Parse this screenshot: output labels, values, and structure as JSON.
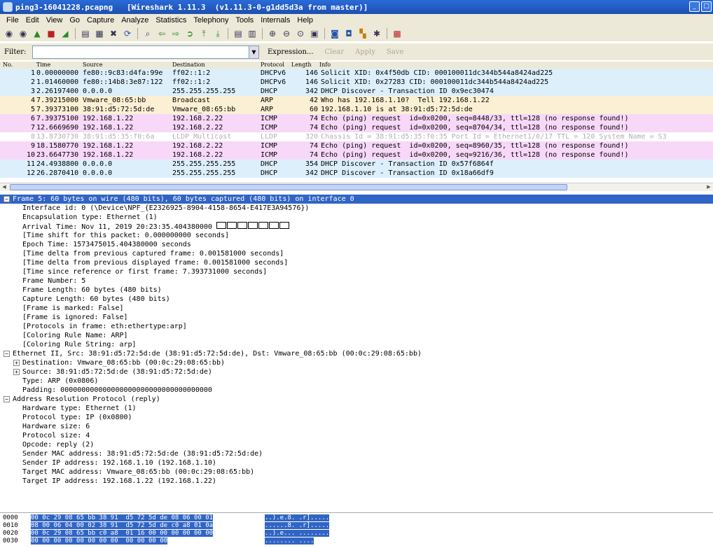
{
  "window": {
    "title": "ping3-16041228.pcapng   [Wireshark 1.11.3  (v1.11.3-0-g1dd5d3a from master)]",
    "buttons": [
      "_",
      "□"
    ]
  },
  "menu": [
    "File",
    "Edit",
    "View",
    "Go",
    "Capture",
    "Analyze",
    "Statistics",
    "Telephony",
    "Tools",
    "Internals",
    "Help"
  ],
  "toolbar": {
    "icons": [
      {
        "name": "interfaces-icon",
        "glyph": "◉",
        "cls": ""
      },
      {
        "name": "options-icon",
        "glyph": "◉",
        "cls": ""
      },
      {
        "name": "start-capture-icon",
        "glyph": "▲",
        "cls": "g"
      },
      {
        "name": "stop-capture-icon",
        "glyph": "■",
        "cls": "r"
      },
      {
        "name": "restart-capture-icon",
        "glyph": "◢",
        "cls": "g"
      },
      {
        "name": "sep"
      },
      {
        "name": "open-file-icon",
        "glyph": "▤",
        "cls": ""
      },
      {
        "name": "save-file-icon",
        "glyph": "▦",
        "cls": ""
      },
      {
        "name": "close-file-icon",
        "glyph": "✖",
        "cls": ""
      },
      {
        "name": "reload-icon",
        "glyph": "⟳",
        "cls": "b"
      },
      {
        "name": "sep"
      },
      {
        "name": "find-packet-icon",
        "glyph": "⌕",
        "cls": ""
      },
      {
        "name": "go-back-icon",
        "glyph": "⇦",
        "cls": "g"
      },
      {
        "name": "go-forward-icon",
        "glyph": "⇨",
        "cls": "g"
      },
      {
        "name": "go-to-packet-icon",
        "glyph": "➲",
        "cls": "g"
      },
      {
        "name": "first-packet-icon",
        "glyph": "⤒",
        "cls": "g"
      },
      {
        "name": "last-packet-icon",
        "glyph": "⤓",
        "cls": "g"
      },
      {
        "name": "sep"
      },
      {
        "name": "colorize-icon",
        "glyph": "▤",
        "cls": ""
      },
      {
        "name": "autoscroll-icon",
        "glyph": "▥",
        "cls": ""
      },
      {
        "name": "sep"
      },
      {
        "name": "zoom-in-icon",
        "glyph": "⊕",
        "cls": ""
      },
      {
        "name": "zoom-out-icon",
        "glyph": "⊖",
        "cls": ""
      },
      {
        "name": "zoom-normal-icon",
        "glyph": "⊙",
        "cls": ""
      },
      {
        "name": "resize-columns-icon",
        "glyph": "▣",
        "cls": ""
      },
      {
        "name": "sep"
      },
      {
        "name": "capture-filters-icon",
        "glyph": "◙",
        "cls": "b"
      },
      {
        "name": "display-filters-icon",
        "glyph": "◘",
        "cls": "b"
      },
      {
        "name": "coloring-rules-icon",
        "glyph": "▚",
        "cls": "o"
      },
      {
        "name": "preferences-icon",
        "glyph": "✱",
        "cls": ""
      },
      {
        "name": "sep"
      },
      {
        "name": "help-icon",
        "glyph": "▩",
        "cls": "r"
      }
    ]
  },
  "filter": {
    "label": "Filter:",
    "value": "",
    "expression": "Expression...",
    "clear": "Clear",
    "apply": "Apply",
    "save": "Save"
  },
  "columns": {
    "no": "No.",
    "time": "Time",
    "source": "Source",
    "destination": "Destination",
    "protocol": "Protocol",
    "length": "Length",
    "info": "Info"
  },
  "colors": {
    "dhcp": "#dceffb",
    "arp": "#fcf0d4",
    "icmp": "#f8d8f8",
    "lldp": "#ffffff",
    "selected": "#3165c5"
  },
  "packets": [
    {
      "no": "1",
      "time": "0.00000000",
      "src": "fe80::9c83:d4fa:99e",
      "dst": "ff02::1:2",
      "proto": "DHCPv6",
      "len": "146",
      "info": "Solicit XID: 0x4f50db CID: 000100011dc344b544a8424ad225",
      "kind": "dhcp"
    },
    {
      "no": "2",
      "time": "1.01460000",
      "src": "fe80::14b8:3e87:122",
      "dst": "ff02::1:2",
      "proto": "DHCPv6",
      "len": "146",
      "info": "Solicit XID: 0x27283 CID: 000100011dc344b544a8424ad225",
      "kind": "dhcp"
    },
    {
      "no": "3",
      "time": "2.26197400",
      "src": "0.0.0.0",
      "dst": "255.255.255.255",
      "proto": "DHCP",
      "len": "342",
      "info": "DHCP Discover - Transaction ID 0x9ec30474",
      "kind": "dhcp"
    },
    {
      "no": "4",
      "time": "7.39215000",
      "src": "Vmware_08:65:bb",
      "dst": "Broadcast",
      "proto": "ARP",
      "len": "42",
      "info": "Who has 192.168.1.10?  Tell 192.168.1.22",
      "kind": "arp"
    },
    {
      "no": "5",
      "time": "7.39373100",
      "src": "38:91:d5:72:5d:de",
      "dst": "Vmware_08:65:bb",
      "proto": "ARP",
      "len": "60",
      "info": "192.168.1.10 is at 38:91:d5:72:5d:de",
      "kind": "arp"
    },
    {
      "no": "6",
      "time": "7.39375100",
      "src": "192.168.1.22",
      "dst": "192.168.2.22",
      "proto": "ICMP",
      "len": "74",
      "info": "Echo (ping) request  id=0x0200, seq=8448/33, ttl=128 (no response found!)",
      "kind": "icmp"
    },
    {
      "no": "7",
      "time": "12.6669690",
      "src": "192.168.1.22",
      "dst": "192.168.2.22",
      "proto": "ICMP",
      "len": "74",
      "info": "Echo (ping) request  id=0x0200, seq=8704/34, ttl=128 (no response found!)",
      "kind": "icmp"
    },
    {
      "no": "8",
      "time": "13.8730730",
      "src": "38:91:d5:35:f0:6a",
      "dst": "LLDP_Multicast",
      "proto": "LLDP",
      "len": "320",
      "info": "Chassis Id = 38:91:d5:35:f0:35 Port Id = Ethernet1/0/17 TTL = 120 System Name = S3",
      "kind": "lldp"
    },
    {
      "no": "9",
      "time": "18.1580770",
      "src": "192.168.1.22",
      "dst": "192.168.2.22",
      "proto": "ICMP",
      "len": "74",
      "info": "Echo (ping) request  id=0x0200, seq=8960/35, ttl=128 (no response found!)",
      "kind": "icmp"
    },
    {
      "no": "10",
      "time": "23.6647730",
      "src": "192.168.1.22",
      "dst": "192.168.2.22",
      "proto": "ICMP",
      "len": "74",
      "info": "Echo (ping) request  id=0x0200, seq=9216/36, ttl=128 (no response found!)",
      "kind": "icmp"
    },
    {
      "no": "11",
      "time": "24.4938800",
      "src": "0.0.0.0",
      "dst": "255.255.255.255",
      "proto": "DHCP",
      "len": "354",
      "info": "DHCP Discover - Transaction ID 0x57f6864f",
      "kind": "dhcp"
    },
    {
      "no": "12",
      "time": "26.2870410",
      "src": "0.0.0.0",
      "dst": "255.255.255.255",
      "proto": "DHCP",
      "len": "342",
      "info": "DHCP Discover - Transaction ID 0x18a66df9",
      "kind": "dhcp"
    }
  ],
  "details": [
    {
      "lvl": 0,
      "exp": "minus",
      "sel": true,
      "text": "Frame 5: 60 bytes on wire (480 bits), 60 bytes captured (480 bits) on interface 0"
    },
    {
      "lvl": 1,
      "text": "Interface id: 0 (\\Device\\NPF_{E2326925-8904-4158-8654-E417E3A94576})"
    },
    {
      "lvl": 1,
      "text": "Encapsulation type: Ethernet (1)"
    },
    {
      "lvl": 1,
      "text": "Arrival Time: Nov 11, 2019 20:23:35.404380000 ",
      "boxes": true
    },
    {
      "lvl": 1,
      "text": "[Time shift for this packet: 0.000000000 seconds]"
    },
    {
      "lvl": 1,
      "text": "Epoch Time: 1573475015.404380000 seconds"
    },
    {
      "lvl": 1,
      "text": "[Time delta from previous captured frame: 0.001581000 seconds]"
    },
    {
      "lvl": 1,
      "text": "[Time delta from previous displayed frame: 0.001581000 seconds]"
    },
    {
      "lvl": 1,
      "text": "[Time since reference or first frame: 7.393731000 seconds]"
    },
    {
      "lvl": 1,
      "text": "Frame Number: 5"
    },
    {
      "lvl": 1,
      "text": "Frame Length: 60 bytes (480 bits)"
    },
    {
      "lvl": 1,
      "text": "Capture Length: 60 bytes (480 bits)"
    },
    {
      "lvl": 1,
      "text": "[Frame is marked: False]"
    },
    {
      "lvl": 1,
      "text": "[Frame is ignored: False]"
    },
    {
      "lvl": 1,
      "text": "[Protocols in frame: eth:ethertype:arp]"
    },
    {
      "lvl": 1,
      "text": "[Coloring Rule Name: ARP]"
    },
    {
      "lvl": 1,
      "text": "[Coloring Rule String: arp]"
    },
    {
      "lvl": 0,
      "exp": "minus",
      "text": "Ethernet II, Src: 38:91:d5:72:5d:de (38:91:d5:72:5d:de), Dst: Vmware_08:65:bb (00:0c:29:08:65:bb)"
    },
    {
      "lvl": 1,
      "exp": "plus",
      "text": "Destination: Vmware_08:65:bb (00:0c:29:08:65:bb)"
    },
    {
      "lvl": 1,
      "exp": "plus",
      "text": "Source: 38:91:d5:72:5d:de (38:91:d5:72:5d:de)"
    },
    {
      "lvl": 1,
      "text": "Type: ARP (0x0806)"
    },
    {
      "lvl": 1,
      "text": "Padding: 000000000000000000000000000000000000"
    },
    {
      "lvl": 0,
      "exp": "minus",
      "text": "Address Resolution Protocol (reply)"
    },
    {
      "lvl": 1,
      "text": "Hardware type: Ethernet (1)"
    },
    {
      "lvl": 1,
      "text": "Protocol type: IP (0x0800)"
    },
    {
      "lvl": 1,
      "text": "Hardware size: 6"
    },
    {
      "lvl": 1,
      "text": "Protocol size: 4"
    },
    {
      "lvl": 1,
      "text": "Opcode: reply (2)"
    },
    {
      "lvl": 1,
      "text": "Sender MAC address: 38:91:d5:72:5d:de (38:91:d5:72:5d:de)"
    },
    {
      "lvl": 1,
      "text": "Sender IP address: 192.168.1.10 (192.168.1.10)"
    },
    {
      "lvl": 1,
      "text": "Target MAC address: Vmware_08:65:bb (00:0c:29:08:65:bb)"
    },
    {
      "lvl": 1,
      "text": "Target IP address: 192.168.1.22 (192.168.1.22)"
    }
  ],
  "hex": [
    {
      "off": "0000",
      "hex": "00 0c 29 08 65 bb 38 91  d5 72 5d de 08 06 00 01",
      "ascii": "..).e.8. .r]....."
    },
    {
      "off": "0010",
      "hex": "08 00 06 04 00 02 38 91  d5 72 5d de c0 a8 01 0a",
      "ascii": "......8. .r]....."
    },
    {
      "off": "0020",
      "hex": "00 0c 29 08 65 bb c0 a8  01 16 00 00 00 00 00 00",
      "ascii": "..).e... ........"
    },
    {
      "off": "0030",
      "hex": "00 00 00 00 00 00 00 00  00 00 00 00",
      "ascii": "........ ...."
    }
  ]
}
